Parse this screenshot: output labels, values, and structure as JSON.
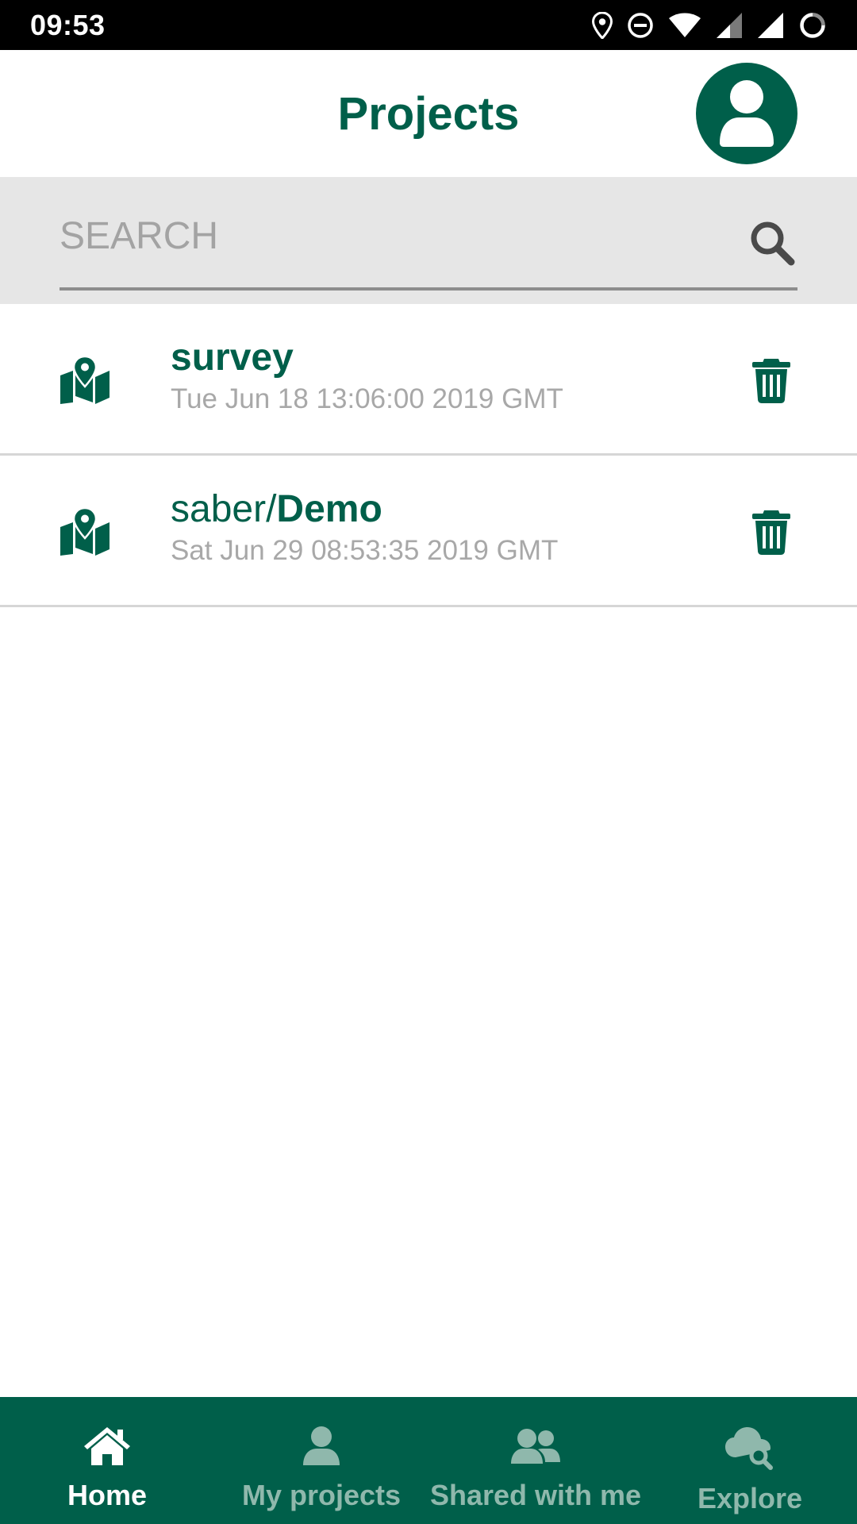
{
  "status_bar": {
    "time": "09:53",
    "icons": [
      "location-icon",
      "do-not-disturb-icon",
      "wifi-icon",
      "signal-icon",
      "signal-icon",
      "sync-icon"
    ]
  },
  "header": {
    "title": "Projects",
    "avatar_icon": "user-avatar-icon"
  },
  "search": {
    "placeholder": "SEARCH",
    "value": "",
    "icon": "search-icon"
  },
  "projects": [
    {
      "name_prefix": "",
      "name_bold": "survey",
      "date": "Tue Jun 18 13:06:00 2019 GMT",
      "icon": "map-marker-icon",
      "action_icon": "trash-icon"
    },
    {
      "name_prefix": "saber/",
      "name_bold": "Demo",
      "date": "Sat Jun 29 08:53:35 2019 GMT",
      "icon": "map-marker-icon",
      "action_icon": "trash-icon"
    }
  ],
  "bottom_nav": {
    "items": [
      {
        "label": "Home",
        "icon": "home-icon",
        "active": true
      },
      {
        "label": "My projects",
        "icon": "person-icon",
        "active": false
      },
      {
        "label": "Shared with me",
        "icon": "people-icon",
        "active": false
      },
      {
        "label": "Explore",
        "icon": "cloud-search-icon",
        "active": false
      }
    ]
  },
  "colors": {
    "brand": "#005f4a",
    "inactive_nav": "#8fb8ac",
    "muted_text": "#a8a8a8",
    "search_bg": "#e6e6e6"
  }
}
